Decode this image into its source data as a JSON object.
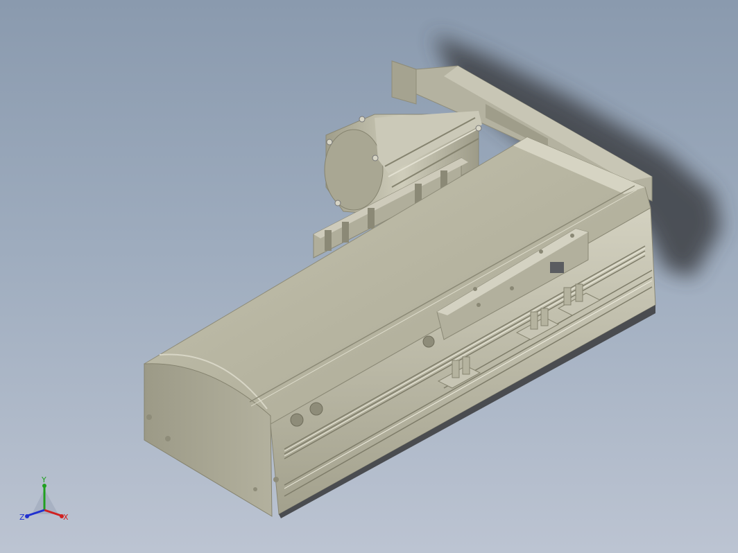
{
  "viewport": {
    "background_top": "#8a9aae",
    "background_bottom": "#bcc4d2"
  },
  "model": {
    "body_color": "#a8a692",
    "highlight_color": "#d2d0bf",
    "shadow_color": "#4a4c50"
  },
  "triad": {
    "x_label": "X",
    "y_label": "Y",
    "z_label": "Z",
    "x_color": "#d02020",
    "y_color": "#20a020",
    "z_color": "#2030d0"
  }
}
